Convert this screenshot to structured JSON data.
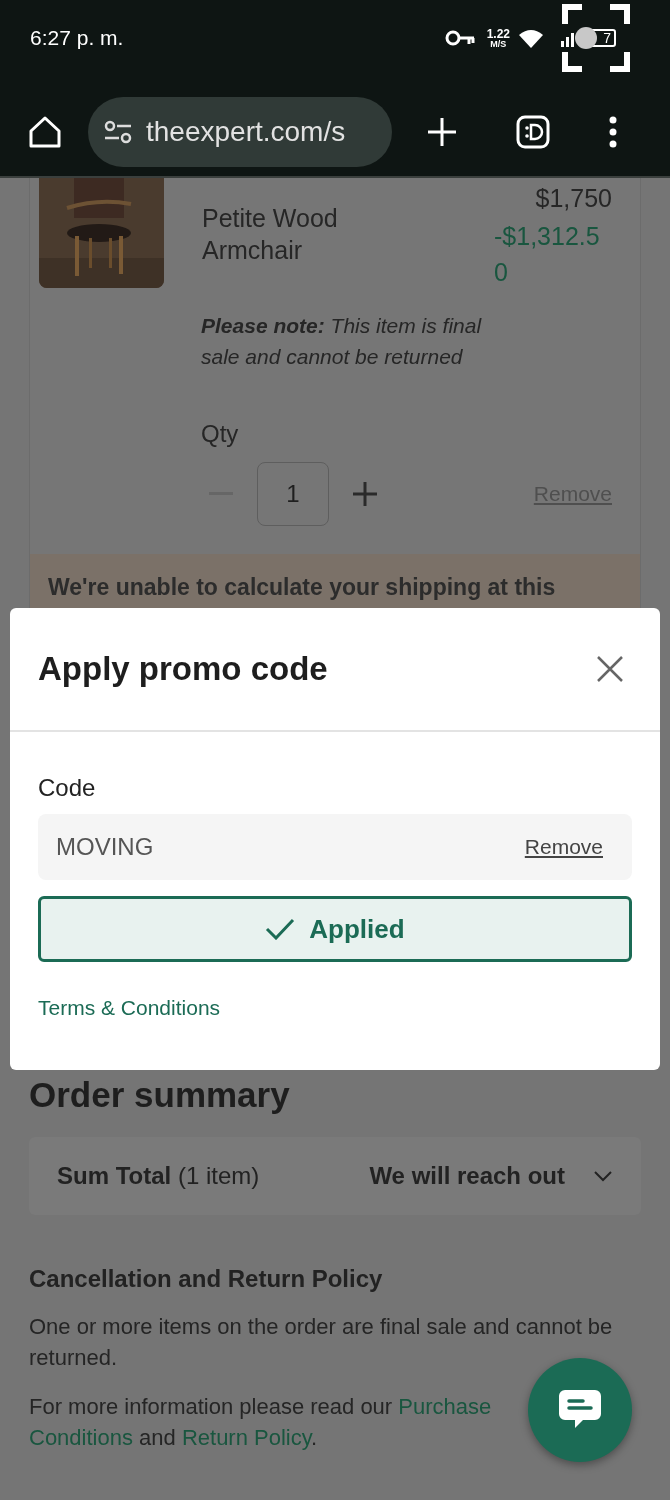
{
  "status_bar": {
    "time": "6:27 p. m.",
    "net_speed": "1.22",
    "net_speed_unit": "M/S",
    "battery": "7"
  },
  "browser": {
    "url": "theexpert.com/s"
  },
  "cart_item": {
    "name": "Petite Wood Armchair",
    "price": "$1,750",
    "discount": "-$1,312.50",
    "note": "**Please note:** This item is final sale and cannot be returned",
    "qty_label": "Qty",
    "qty": "1",
    "decrement_disabled": true,
    "remove": "Remove"
  },
  "shipping_notice": "We're unable to calculate your shipping at this",
  "promo_dialog": {
    "title": "Apply promo code",
    "code_label": "Code",
    "code": "MOVING",
    "remove": "Remove",
    "button": "Applied",
    "applied": true,
    "terms": "Terms & Conditions"
  },
  "order_summary": {
    "title": "Order summary",
    "total_label": "**Sum Total** (1 item)",
    "total_value": "We will reach out",
    "expanded": false
  },
  "policy": {
    "title": "Cancellation and Return Policy",
    "text": "One or more items on the order are final sale and cannot be returned.",
    "prefix": "For more information please read our ",
    "link_1a": "Purchase",
    "link_1b": "Conditions",
    "middle": " and ",
    "link_2": "Return Policy",
    "end": "."
  }
}
